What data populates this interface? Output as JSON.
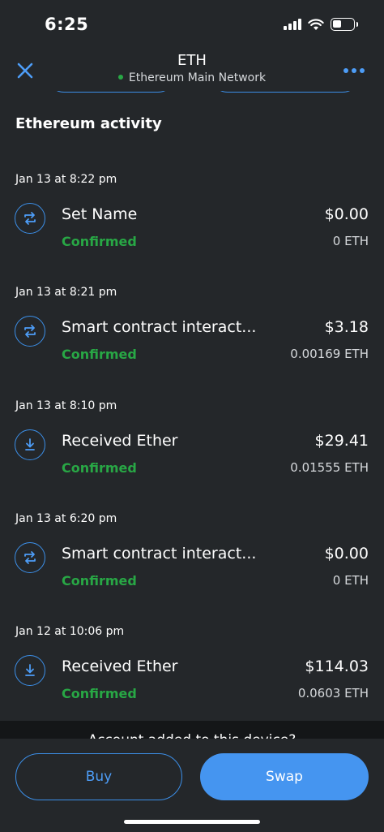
{
  "status_bar": {
    "time": "6:25",
    "battery_level": 0.45
  },
  "header": {
    "title": "ETH",
    "network": "Ethereum Main Network"
  },
  "section_title": "Ethereum activity",
  "transactions": [
    {
      "date": "Jan 13 at 8:22 pm",
      "title": "Set Name",
      "status": "Confirmed",
      "fiat": "$0.00",
      "amount": "0 ETH",
      "icon": "swap-arrows-icon"
    },
    {
      "date": "Jan 13 at 8:21 pm",
      "title": "Smart contract interact...",
      "status": "Confirmed",
      "fiat": "$3.18",
      "amount": "0.00169 ETH",
      "icon": "swap-arrows-icon"
    },
    {
      "date": "Jan 13 at 8:10 pm",
      "title": "Received Ether",
      "status": "Confirmed",
      "fiat": "$29.41",
      "amount": "0.01555 ETH",
      "icon": "receive-icon"
    },
    {
      "date": "Jan 13 at 6:20 pm",
      "title": "Smart contract interact...",
      "status": "Confirmed",
      "fiat": "$0.00",
      "amount": "0 ETH",
      "icon": "swap-arrows-icon"
    },
    {
      "date": "Jan 12 at 10:06 pm",
      "title": "Received Ether",
      "status": "Confirmed",
      "fiat": "$114.03",
      "amount": "0.0603 ETH",
      "icon": "receive-icon"
    }
  ],
  "footer_peek_text": "Account added to this device?",
  "actions": {
    "buy_label": "Buy",
    "swap_label": "Swap"
  },
  "colors": {
    "background": "#24272a",
    "accent": "#4595f0",
    "success": "#28a745"
  }
}
